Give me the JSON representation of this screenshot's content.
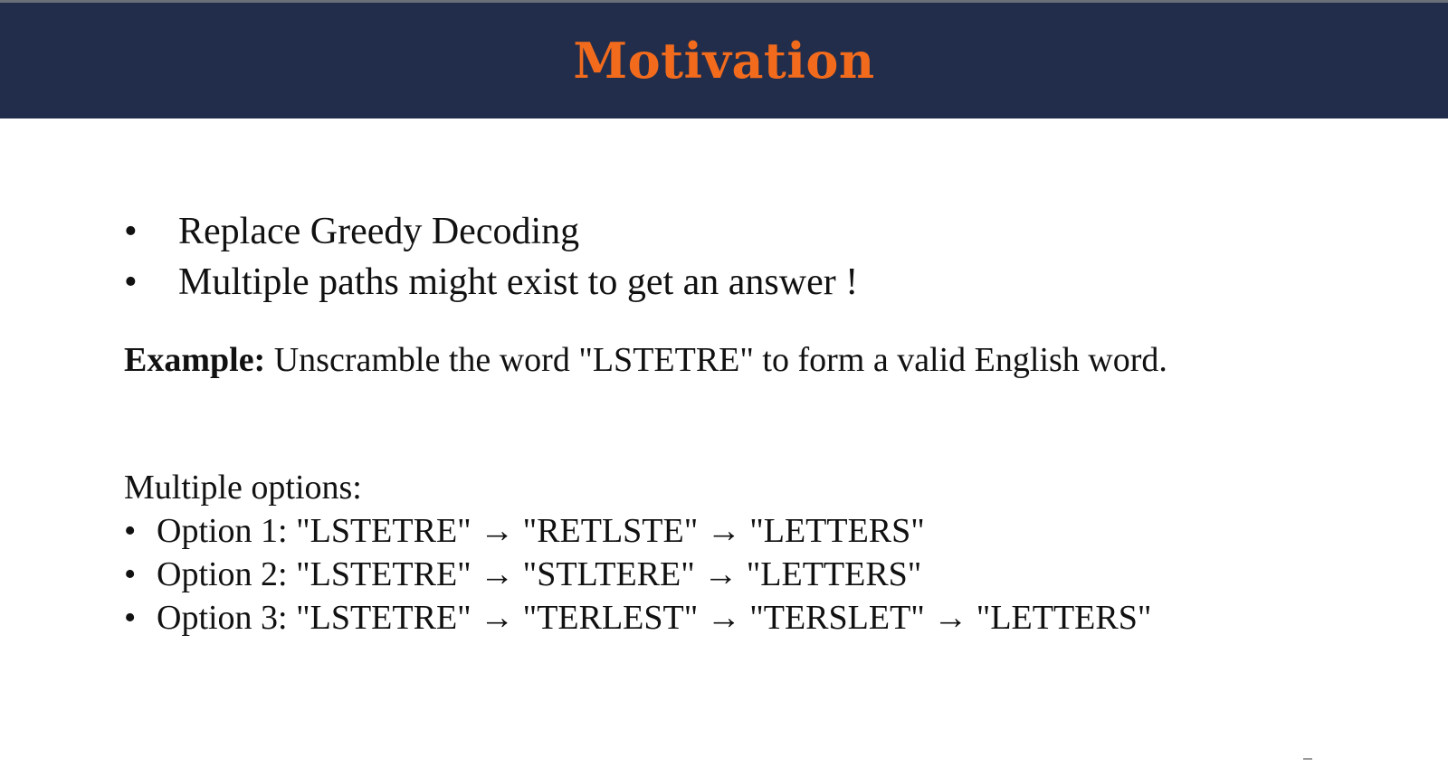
{
  "slide": {
    "title": "Motivation",
    "title_color": "#f26b1d",
    "header_color": "#222d4b",
    "bullets": [
      {
        "marker": "•",
        "text": "Replace Greedy Decoding"
      },
      {
        "marker": "•",
        "text": "Multiple paths might exist to get an answer !"
      }
    ],
    "example": {
      "label": "Example:",
      "text": " Unscramble the word \"LSTETRE\" to form a valid English word."
    },
    "options_heading": "Multiple options:",
    "options": [
      {
        "marker": "•",
        "text": "Option 1: \"LSTETRE\" → \"RETLSTE\" → \"LETTERS\""
      },
      {
        "marker": "•",
        "text": "Option 2: \"LSTETRE\" → \"STLTERE\" → \"LETTERS\""
      },
      {
        "marker": "•",
        "text": "Option 3: \"LSTETRE\" → \"TERLEST\" → \"TERSLET\" → \"LETTERS\""
      }
    ]
  }
}
